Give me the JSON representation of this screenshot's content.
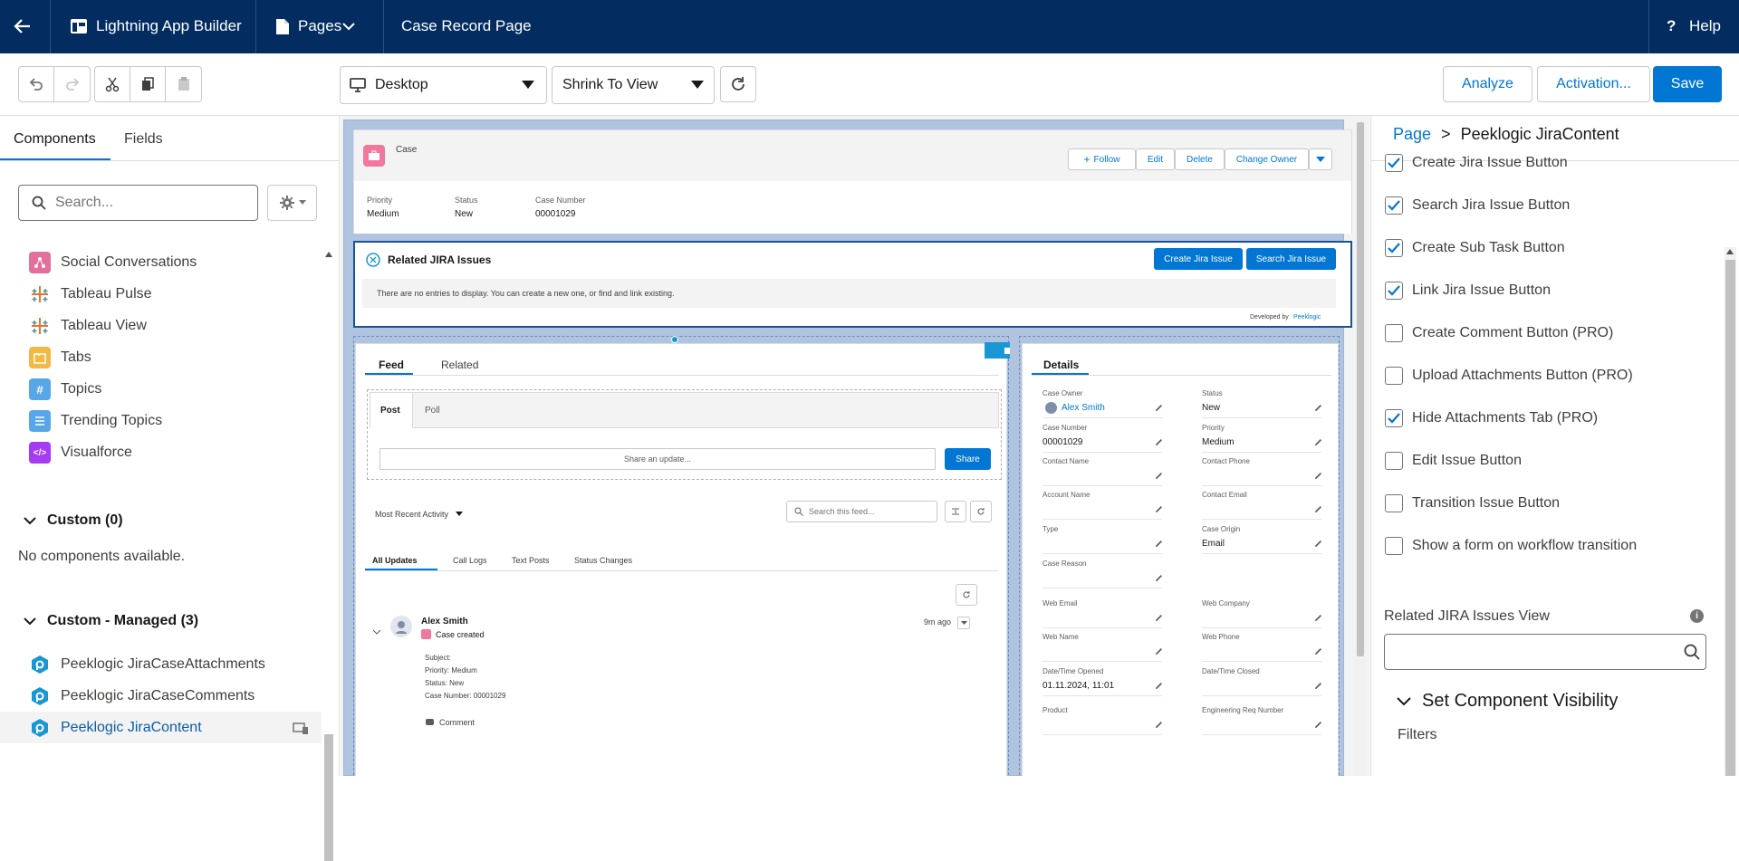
{
  "topbar": {
    "app_name": "Lightning App Builder",
    "pages_label": "Pages",
    "page_name": "Case Record Page",
    "help_label": "Help"
  },
  "toolbar": {
    "device": "Desktop",
    "zoom": "Shrink To View",
    "analyze": "Analyze",
    "activation": "Activation...",
    "save": "Save"
  },
  "left": {
    "tabs": [
      "Components",
      "Fields"
    ],
    "search_placeholder": "Search...",
    "items": [
      {
        "label": "Social Conversations",
        "icon": "social-conversations-icon",
        "color": "#e3709a"
      },
      {
        "label": "Tableau Pulse",
        "icon": "tableau-icon",
        "color": "#ffffff"
      },
      {
        "label": "Tableau View",
        "icon": "tableau-icon",
        "color": "#ffffff"
      },
      {
        "label": "Tabs",
        "icon": "tabs-icon",
        "color": "#f4b944"
      },
      {
        "label": "Topics",
        "icon": "topics-icon",
        "color": "#57a7e8"
      },
      {
        "label": "Trending Topics",
        "icon": "trending-topics-icon",
        "color": "#57a7e8"
      },
      {
        "label": "Visualforce",
        "icon": "visualforce-icon",
        "color": "#a63cf1"
      }
    ],
    "custom_header": "Custom (0)",
    "custom_empty": "No components available.",
    "managed_header": "Custom - Managed (3)",
    "managed_items": [
      "Peeklogic JiraCaseAttachments",
      "Peeklogic JiraCaseComments",
      "Peeklogic JiraContent"
    ]
  },
  "canvas": {
    "header": {
      "object": "Case",
      "follow": "Follow",
      "edit": "Edit",
      "delete": "Delete",
      "change_owner": "Change Owner",
      "fields": [
        {
          "label": "Priority",
          "value": "Medium"
        },
        {
          "label": "Status",
          "value": "New"
        },
        {
          "label": "Case Number",
          "value": "00001029"
        }
      ]
    },
    "jira": {
      "title": "Related JIRA Issues",
      "create": "Create Jira Issue",
      "search": "Search Jira Issue",
      "empty": "There are no entries to display. You can create a new one, or find and link existing.",
      "dev_by": "Developed by",
      "dev_link": "Peeklogic"
    },
    "feed": {
      "tabs": [
        "Feed",
        "Related"
      ],
      "post_tabs": [
        "Post",
        "Poll"
      ],
      "share_placeholder": "Share an update...",
      "share": "Share",
      "sort": "Most Recent Activity",
      "search_placeholder": "Search this feed...",
      "filters": [
        "All Updates",
        "Call Logs",
        "Text Posts",
        "Status Changes"
      ],
      "item": {
        "author": "Alex Smith",
        "action": "Case created",
        "time": "9m ago",
        "lines": [
          "Subject:",
          "Priority: Medium",
          "Status: New",
          "Case Number: 00001029"
        ],
        "comment": "Comment"
      }
    },
    "details": {
      "title": "Details",
      "fields": [
        {
          "label": "Case Owner",
          "value": "Alex Smith"
        },
        {
          "label": "Status",
          "value": "New"
        },
        {
          "label": "Case Number",
          "value": "00001029"
        },
        {
          "label": "Priority",
          "value": "Medium"
        },
        {
          "label": "Contact Name",
          "value": ""
        },
        {
          "label": "Contact Phone",
          "value": ""
        },
        {
          "label": "Account Name",
          "value": ""
        },
        {
          "label": "Contact Email",
          "value": ""
        },
        {
          "label": "Type",
          "value": ""
        },
        {
          "label": "Case Origin",
          "value": "Email"
        },
        {
          "label": "Case Reason",
          "value": ""
        },
        {
          "label": "Web Email",
          "value": ""
        },
        {
          "label": "Web Company",
          "value": ""
        },
        {
          "label": "Web Name",
          "value": ""
        },
        {
          "label": "Web Phone",
          "value": ""
        },
        {
          "label": "Date/Time Opened",
          "value": "01.11.2024, 11:01"
        },
        {
          "label": "Date/Time Closed",
          "value": ""
        },
        {
          "label": "Product",
          "value": ""
        },
        {
          "label": "Engineering Req Number",
          "value": ""
        }
      ]
    }
  },
  "right": {
    "breadcrumb_root": "Page",
    "breadcrumb_sep": ">",
    "breadcrumb_current": "Peeklogic JiraContent",
    "options": [
      {
        "label": "Create Jira Issue Button",
        "checked": true
      },
      {
        "label": "Search Jira Issue Button",
        "checked": true
      },
      {
        "label": "Create Sub Task Button",
        "checked": true
      },
      {
        "label": "Link Jira Issue Button",
        "checked": true
      },
      {
        "label": "Create Comment Button (PRO)",
        "checked": false
      },
      {
        "label": "Upload Attachments Button (PRO)",
        "checked": false
      },
      {
        "label": "Hide Attachments Tab (PRO)",
        "checked": true
      },
      {
        "label": "Edit Issue Button",
        "checked": false
      },
      {
        "label": "Transition Issue Button",
        "checked": false
      },
      {
        "label": "Show a form on workflow transition",
        "checked": false
      }
    ],
    "view_label": "Related JIRA Issues View",
    "visibility": "Set Component Visibility",
    "filters": "Filters"
  },
  "colors": {
    "brand_dark": "#032d60",
    "brand": "#0176d3"
  }
}
